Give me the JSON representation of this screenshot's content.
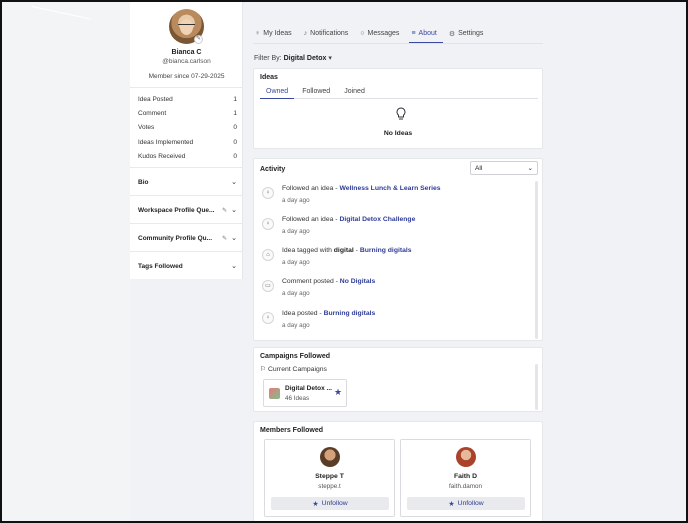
{
  "profile": {
    "name": "Bianca C",
    "handle": "@bianca.carlson",
    "member_since": "Member since 07-29-2025",
    "stats": [
      {
        "label": "Idea Posted",
        "value": "1"
      },
      {
        "label": "Comment",
        "value": "1"
      },
      {
        "label": "Votes",
        "value": "0"
      },
      {
        "label": "Ideas Implemented",
        "value": "0"
      },
      {
        "label": "Kudos Received",
        "value": "0"
      }
    ],
    "sections": {
      "bio": "Bio",
      "workspace": "Workspace Profile Que...",
      "community": "Community Profile Qu...",
      "tags": "Tags Followed"
    }
  },
  "nav": {
    "tabs": [
      {
        "label": "My Ideas",
        "icon": "bulb-icon"
      },
      {
        "label": "Notifications",
        "icon": "bell-icon"
      },
      {
        "label": "Messages",
        "icon": "chat-icon"
      },
      {
        "label": "About",
        "icon": "list-icon"
      },
      {
        "label": "Settings",
        "icon": "gear-icon"
      }
    ],
    "active": "About"
  },
  "filter": {
    "label": "Filter By:",
    "value": "Digital Detox"
  },
  "ideas": {
    "title": "Ideas",
    "subtabs": [
      "Owned",
      "Followed",
      "Joined"
    ],
    "active_subtab": "Owned",
    "empty_text": "No Ideas"
  },
  "activity": {
    "title": "Activity",
    "filter_value": "All",
    "items": [
      {
        "icon": "bulb-icon",
        "text": "Followed an idea - ",
        "highlight": "",
        "mid": "",
        "link": "Wellness Lunch & Learn Series",
        "time": "a day ago"
      },
      {
        "icon": "bulb-icon",
        "text": "Followed an idea - ",
        "highlight": "",
        "mid": "",
        "link": "Digital Detox Challenge",
        "time": "a day ago"
      },
      {
        "icon": "tag-icon",
        "text": "Idea tagged with ",
        "highlight": "digital",
        "mid": " - ",
        "link": "Burning digitals",
        "time": "a day ago"
      },
      {
        "icon": "comment-icon",
        "text": "Comment posted - ",
        "highlight": "",
        "mid": "",
        "link": "No Digitals",
        "time": "a day ago"
      },
      {
        "icon": "bulb-icon",
        "text": "Idea posted - ",
        "highlight": "",
        "mid": "",
        "link": "Burning digitals",
        "time": "a day ago"
      }
    ]
  },
  "campaigns": {
    "title": "Campaigns Followed",
    "subtitle": "Current Campaigns",
    "items": [
      {
        "name": "Digital Detox ...",
        "count": "46 Ideas"
      }
    ]
  },
  "members": {
    "title": "Members Followed",
    "items": [
      {
        "name": "Steppe T",
        "handle": "steppe.t",
        "button": "Unfollow"
      },
      {
        "name": "Faith D",
        "handle": "faith.damon",
        "button": "Unfollow"
      }
    ]
  },
  "colors": {
    "accent": "#3b4aa0",
    "link": "#2f3c97"
  }
}
